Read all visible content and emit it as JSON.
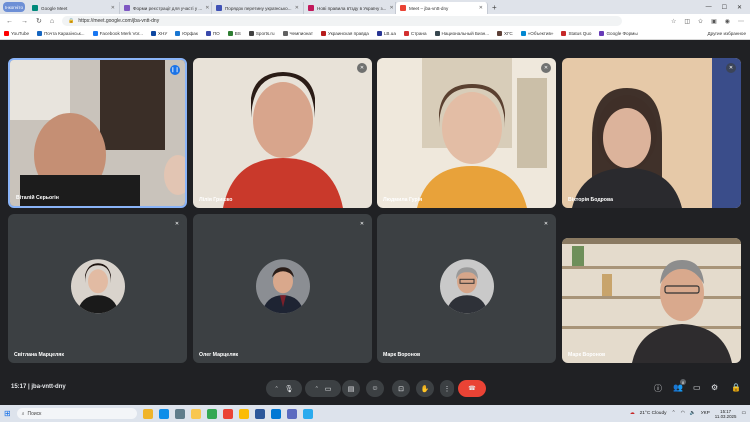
{
  "browser": {
    "profile_label": "Інкогніто",
    "tabs": [
      {
        "title": "Google Meet",
        "color": "#00897b"
      },
      {
        "title": "Форми реєстрації для участі у ...",
        "color": "#7e57c2"
      },
      {
        "title": "Порядок перетину українсько...",
        "color": "#3f51b5"
      },
      {
        "title": "Нові правила в'їзду в Україну з...",
        "color": "#c2185b"
      },
      {
        "title": "Meet – jba-vntt-dny",
        "color": "#ea4335",
        "active": true
      }
    ],
    "url": "https://meet.google.com/jba-vntt-dny",
    "bookmarks": [
      {
        "label": "YouTube",
        "color": "#ff0000"
      },
      {
        "label": "Почта Каразінськ...",
        "color": "#1565c0"
      },
      {
        "label": "Facebook Merk Vor...",
        "color": "#1877f2"
      },
      {
        "label": "ХНУ",
        "color": "#0d47a1"
      },
      {
        "label": "Юрфак",
        "color": "#1976d2"
      },
      {
        "label": "ПО",
        "color": "#3949ab"
      },
      {
        "label": "BS",
        "color": "#2e7d32"
      },
      {
        "label": "Sports.ru",
        "color": "#424242"
      },
      {
        "label": "Чемпионат",
        "color": "#616161"
      },
      {
        "label": "Украинская правда",
        "color": "#b71c1c"
      },
      {
        "label": "LB.ua",
        "color": "#283593"
      },
      {
        "label": "Страна",
        "color": "#d32f2f"
      },
      {
        "label": "Национальный Бизн...",
        "color": "#37474f"
      },
      {
        "label": "ХГС",
        "color": "#5d4037"
      },
      {
        "label": "«Объектив»",
        "color": "#0288d1"
      },
      {
        "label": "Status Quo",
        "color": "#c62828"
      },
      {
        "label": "Google Формы",
        "color": "#673ab7"
      }
    ],
    "bookmarks_other": "Другие избранное"
  },
  "meet": {
    "time": "15:17",
    "code": "jba-vntt-dny",
    "participants": [
      {
        "name": "Віталій Серьогін",
        "bg": "#6b5a4a",
        "speaking": true
      },
      {
        "name": "Лілія Гришко",
        "bg": "#8a4b3a"
      },
      {
        "name": "Людмила Гурія",
        "bg": "#d7c6a3"
      },
      {
        "name": "Вікторія Бодрова",
        "bg": "#5a4c46"
      },
      {
        "name": "Світлана Марцеляк",
        "avatar_bg": "#d9d3cc"
      },
      {
        "name": "Олег Марцеляк",
        "avatar_bg": "#8b8e93"
      },
      {
        "name": "Марк Воронов",
        "avatar_bg": "#c9c9c9"
      },
      {
        "name": "Марк Воронов",
        "bg": "#cfc4b2"
      }
    ],
    "participant_count": "8"
  },
  "taskbar": {
    "search_placeholder": "Поиск",
    "weather": "21°C  Cloudy",
    "lang": "УКР",
    "time": "15:17",
    "date": "11.03.2025"
  }
}
